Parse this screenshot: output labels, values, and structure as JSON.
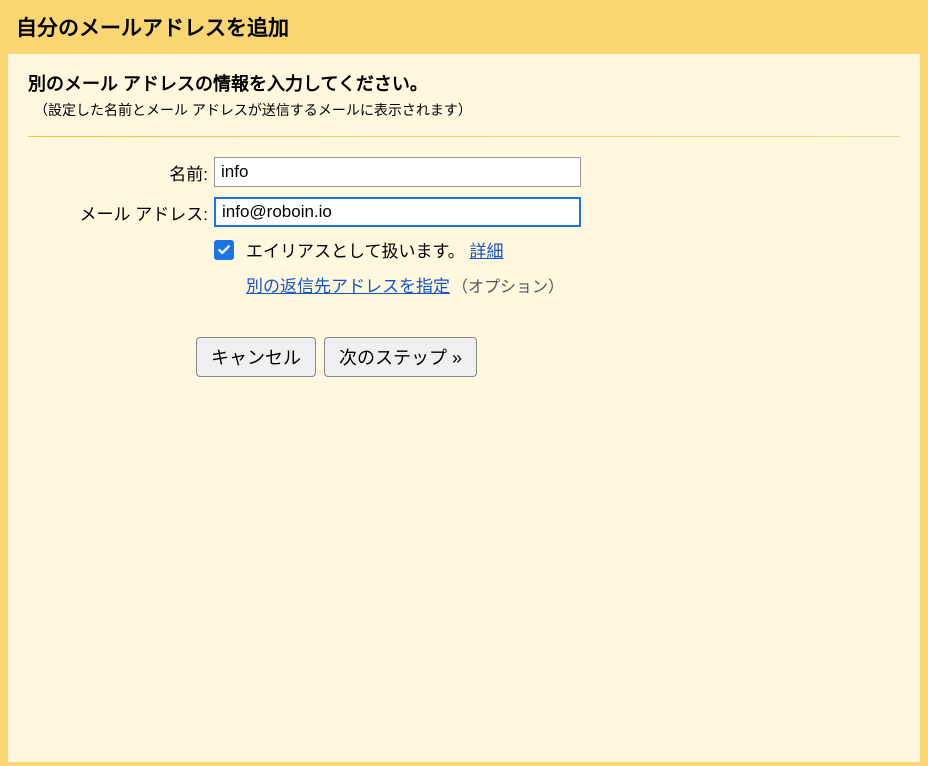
{
  "header": {
    "title": "自分のメールアドレスを追加"
  },
  "content": {
    "subtitle": "別のメール アドレスの情報を入力してください。",
    "description": "（設定した名前とメール アドレスが送信するメールに表示されます）"
  },
  "form": {
    "name_label": "名前:",
    "name_value": "info",
    "email_label": "メール アドレス:",
    "email_value": "info@roboin.io",
    "alias_checkbox_label": "エイリアスとして扱います。",
    "alias_detail_link": "詳細",
    "reply_to_link": "別の返信先アドレスを指定",
    "option_suffix": "（オプション）"
  },
  "buttons": {
    "cancel": "キャンセル",
    "next": "次のステップ »"
  }
}
